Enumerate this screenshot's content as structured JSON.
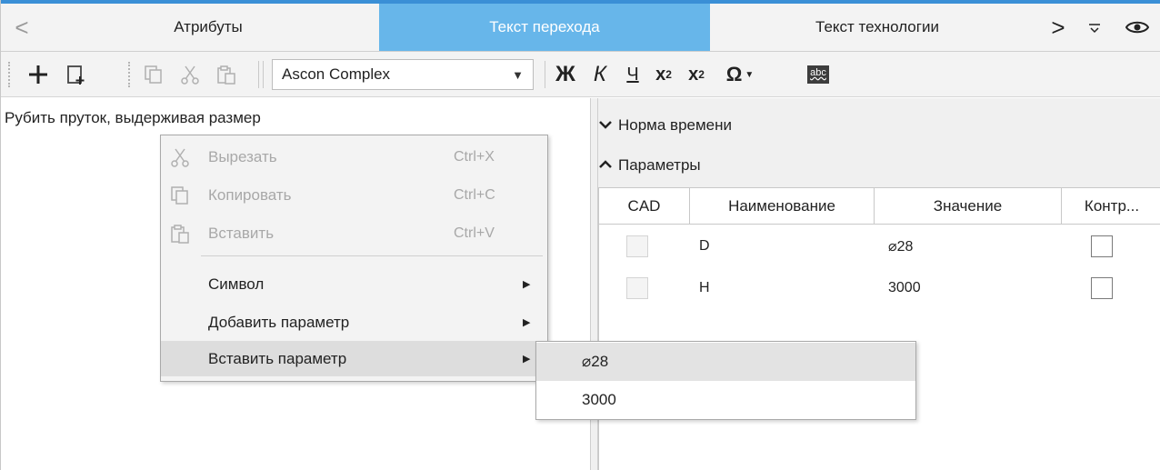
{
  "tabs": {
    "prev_glyph": "<",
    "next_glyph": ">",
    "items": [
      {
        "label": "Атрибуты"
      },
      {
        "label": "Текст перехода"
      },
      {
        "label": "Текст технологии"
      }
    ],
    "active_index": 1,
    "overflow_glyph": "⩡",
    "eye_glyph": "👁"
  },
  "toolbar": {
    "add_glyph": "+",
    "font_name": "Ascon Complex",
    "bold_glyph": "Ж",
    "italic_glyph": "К",
    "underline_glyph": "Ч",
    "subscript_base": "x",
    "subscript_mark": "2",
    "superscript_base": "x",
    "superscript_mark": "2",
    "symbol_glyph": "Ω",
    "spell_label": "abc"
  },
  "editor": {
    "text": "Рубить пруток, выдерживая размер"
  },
  "context_menu": {
    "items": [
      {
        "label": "Вырезать",
        "shortcut": "Ctrl+X"
      },
      {
        "label": "Копировать",
        "shortcut": "Ctrl+C"
      },
      {
        "label": "Вставить",
        "shortcut": "Ctrl+V"
      },
      {
        "label": "Символ"
      },
      {
        "label": "Добавить параметр"
      },
      {
        "label": "Вставить параметр"
      }
    ],
    "submenu_arrow": "▶"
  },
  "submenu": {
    "items": [
      {
        "label": "⌀28"
      },
      {
        "label": "3000"
      }
    ]
  },
  "right_panel": {
    "sections": [
      {
        "label": "Норма времени",
        "chevron": "❯"
      },
      {
        "label": "Параметры",
        "chevron": "❯"
      }
    ],
    "table": {
      "columns": [
        "CAD",
        "Наименование",
        "Значение",
        "Контр..."
      ],
      "rows": [
        {
          "name": "D",
          "value": "⌀28"
        },
        {
          "name": "H",
          "value": "3000"
        }
      ]
    }
  }
}
